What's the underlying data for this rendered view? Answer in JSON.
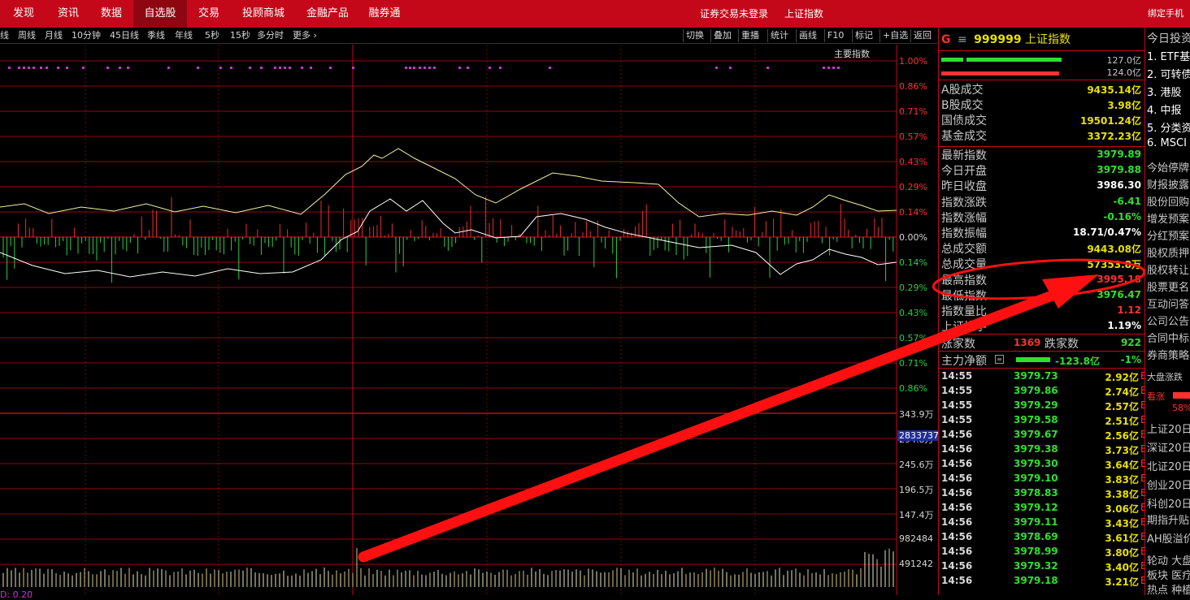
{
  "topbar": {
    "nav": [
      "发现",
      "资讯",
      "数据",
      "自选股",
      "交易",
      "投顾商城",
      "金融产品",
      "融券通"
    ],
    "active": "自选股",
    "status": "证券交易未登录",
    "index_name": "上证指数",
    "bind_phone": "绑定手机"
  },
  "toolbar": {
    "periods": [
      "线",
      "周线",
      "月线",
      "10分钟",
      "45日线",
      "季线",
      "年线",
      "5秒",
      "15秒",
      "多分时",
      "更多"
    ],
    "more_icon": "chevron-right-icon",
    "tools": [
      "切换",
      "叠加",
      "重播",
      "统计",
      "画线",
      "F10",
      "标记",
      "+自选",
      "返回"
    ]
  },
  "chart": {
    "main_index_label": "主要指数",
    "right_axis_up": [
      "1.00%",
      "0.86%",
      "0.71%",
      "0.57%",
      "0.43%",
      "0.29%",
      "0.14%",
      "0.00%"
    ],
    "right_axis_down": [
      "0.14%",
      "0.29%",
      "0.43%",
      "0.57%",
      "0.71%",
      "0.86%"
    ],
    "volume_axis": [
      "343.9万",
      "294.8万",
      "245.6万",
      "196.5万",
      "147.4万",
      "982484",
      "491242"
    ],
    "crosshair_value": "2833737",
    "bottom_partial": "D: 0.20",
    "colors": {
      "up": "#e8302b",
      "down": "#2ecc40",
      "white_line": "#ffffff",
      "yellow_line": "#f0e000",
      "grid": "#c4081a",
      "marker": "#d030d0"
    }
  },
  "panel": {
    "header": {
      "prefix": "G",
      "menu_icon": "menu-icon",
      "code": "999999",
      "name": "上证指数"
    },
    "strength": {
      "up": "127.0亿",
      "down": "124.0亿"
    },
    "turnover": [
      {
        "label": "A股成交",
        "value": "9435.14亿"
      },
      {
        "label": "B股成交",
        "value": "3.98亿"
      },
      {
        "label": "国债成交",
        "value": "19501.24亿"
      },
      {
        "label": "基金成交",
        "value": "3372.23亿"
      }
    ],
    "stats": [
      {
        "label": "最新指数",
        "value": "3979.89",
        "color": "#2ee02e"
      },
      {
        "label": "今日开盘",
        "value": "3979.88",
        "color": "#2ee02e"
      },
      {
        "label": "昨日收盘",
        "value": "3986.30",
        "color": "#ffffff"
      },
      {
        "label": "指数涨跌",
        "value": "-6.41",
        "color": "#2ee02e"
      },
      {
        "label": "指数涨幅",
        "value": "-0.16%",
        "color": "#2ee02e"
      },
      {
        "label": "指数振幅",
        "value": "18.71/0.47%",
        "color": "#ffffff"
      },
      {
        "label": "总成交额",
        "value": "9443.08亿",
        "color": "#e8e000"
      },
      {
        "label": "总成交量",
        "value": "57353.8万",
        "color": "#e8e000"
      },
      {
        "label": "最高指数",
        "value": "3995.18",
        "color": "#ff3030"
      },
      {
        "label": "最低指数",
        "value": "3976.47",
        "color": "#2ee02e"
      },
      {
        "label": "指数量比",
        "value": "1.12",
        "color": "#ff3030"
      },
      {
        "label": "上证换手",
        "value": "1.19%",
        "color": "#ffffff"
      }
    ],
    "breadth": {
      "up_label": "涨家数",
      "up_value": "1369",
      "down_label": "跌家数",
      "down_value": "922"
    },
    "main_flow": {
      "label": "主力净额",
      "value": "-123.8亿",
      "pct": "-1%"
    },
    "ticks": [
      {
        "t": "14:55",
        "p": "3979.73",
        "v": "2.92亿"
      },
      {
        "t": "14:55",
        "p": "3979.86",
        "v": "2.74亿"
      },
      {
        "t": "14:55",
        "p": "3979.29",
        "v": "2.57亿"
      },
      {
        "t": "14:55",
        "p": "3979.58",
        "v": "2.51亿"
      },
      {
        "t": "14:56",
        "p": "3979.67",
        "v": "2.56亿"
      },
      {
        "t": "14:56",
        "p": "3979.38",
        "v": "3.73亿"
      },
      {
        "t": "14:56",
        "p": "3979.30",
        "v": "3.64亿"
      },
      {
        "t": "14:56",
        "p": "3979.10",
        "v": "3.83亿"
      },
      {
        "t": "14:56",
        "p": "3978.83",
        "v": "3.38亿"
      },
      {
        "t": "14:56",
        "p": "3979.12",
        "v": "3.06亿"
      },
      {
        "t": "14:56",
        "p": "3979.11",
        "v": "3.43亿"
      },
      {
        "t": "14:56",
        "p": "3978.69",
        "v": "3.61亿"
      },
      {
        "t": "14:56",
        "p": "3978.99",
        "v": "3.80亿"
      },
      {
        "t": "14:56",
        "p": "3979.32",
        "v": "3.40亿"
      },
      {
        "t": "14:56",
        "p": "3979.18",
        "v": "3.21亿"
      }
    ],
    "tick_marker": "B"
  },
  "side": {
    "title": "今日投资",
    "list": [
      "1. ETF基",
      "2. 可转债",
      "3. 港股",
      "4. 中报",
      "5. 分类资",
      "6. MSCI"
    ],
    "items": [
      "今始停牌",
      "财报披露",
      "股份回购",
      "增发预案",
      "分红预案",
      "股权质押",
      "股权转让",
      "股票更名",
      "互动问答",
      "公司公告",
      "合同中标",
      "券商策略"
    ],
    "breadth_title": "大盘涨跌",
    "bullish": "看涨",
    "bullish_pct": "58%",
    "streaks": [
      "上证20日",
      "深证20日",
      "北证20日",
      "创业20日",
      "科创20日"
    ],
    "bottom": [
      "期指升贴",
      "AH股溢价",
      "轮动 大盘",
      "板块 医疗",
      "热点 种植"
    ]
  },
  "annotation": {
    "note": "red arrow and ellipse highlighting 最高指数"
  }
}
